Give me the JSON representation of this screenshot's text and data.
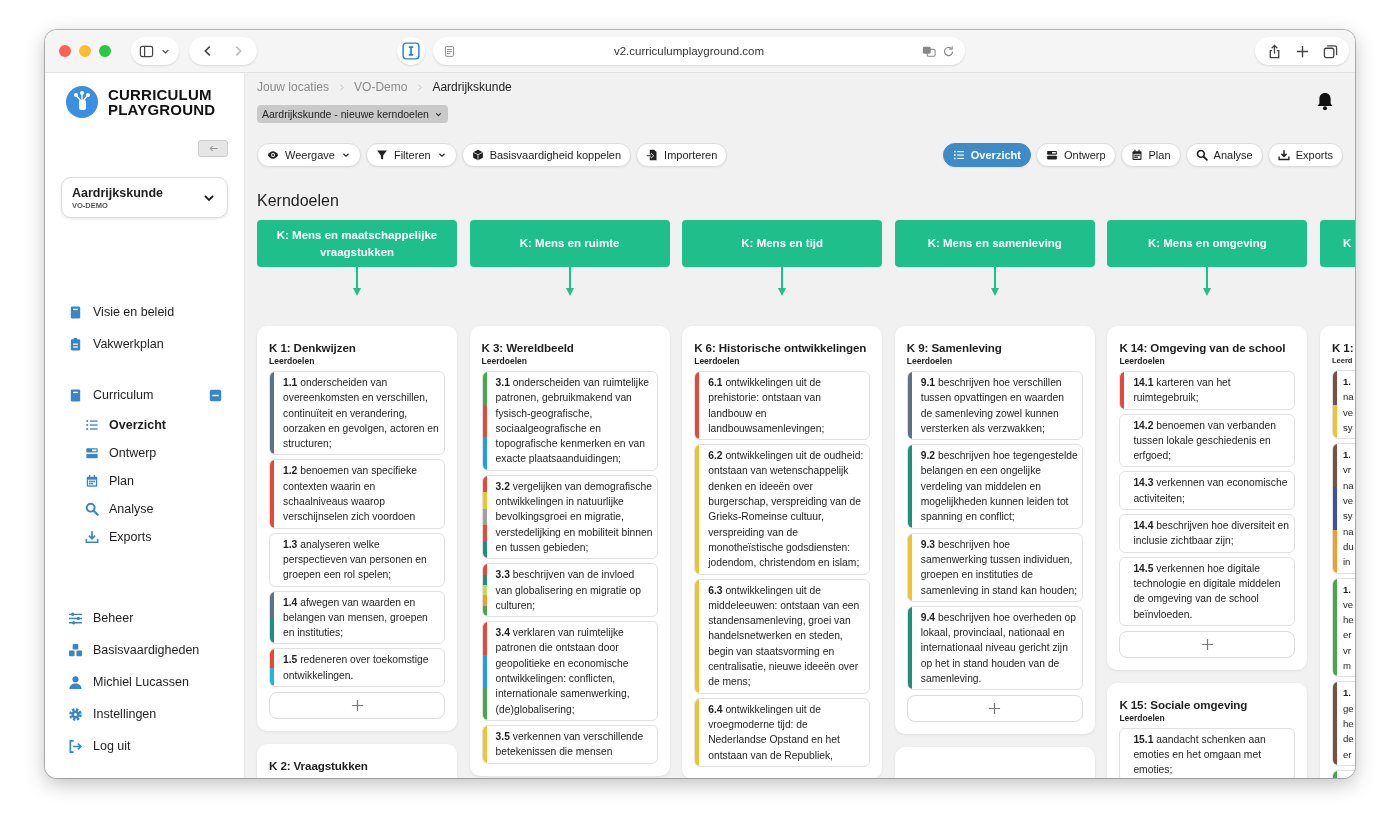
{
  "browser": {
    "url": "v2.curriculumplayground.com"
  },
  "sidebar": {
    "logo_lines": [
      "CURRICULUM",
      "PLAYGROUND"
    ],
    "subject": {
      "name": "Aardrijkskunde",
      "school": "VO-DEMO"
    },
    "nav": [
      {
        "label": "Visie en beleid",
        "selected": false
      },
      {
        "label": "Vakwerkplan",
        "selected": false
      },
      {
        "label": "Curriculum",
        "selected": false,
        "expanded": true,
        "children": [
          {
            "label": "Overzicht",
            "selected": true
          },
          {
            "label": "Ontwerp",
            "selected": false
          },
          {
            "label": "Plan",
            "selected": false
          },
          {
            "label": "Analyse",
            "selected": false
          },
          {
            "label": "Exports",
            "selected": false
          }
        ]
      }
    ],
    "footer_nav": [
      {
        "label": "Beheer",
        "selected": false
      },
      {
        "label": "Basisvaardigheden",
        "selected": false
      },
      {
        "label": "Michiel Lucassen",
        "selected": false
      },
      {
        "label": "Instellingen",
        "selected": false
      },
      {
        "label": "Log uit",
        "selected": false
      }
    ]
  },
  "breadcrumb": [
    "Jouw locaties",
    "VO-Demo",
    "Aardrijkskunde"
  ],
  "version_select": "Aardrijkskunde - nieuwe kerndoelen",
  "tools": [
    {
      "label": "Weergave",
      "dropdown": true
    },
    {
      "label": "Filteren",
      "dropdown": true
    },
    {
      "label": "Basisvaardigheid koppelen",
      "dropdown": false
    },
    {
      "label": "Importeren",
      "dropdown": false
    }
  ],
  "views": [
    {
      "label": "Overzicht",
      "selected": true
    },
    {
      "label": "Ontwerp",
      "selected": false
    },
    {
      "label": "Plan",
      "selected": false
    },
    {
      "label": "Analyse",
      "selected": false
    },
    {
      "label": "Exports",
      "selected": false
    }
  ],
  "section_title": "Kerndoelen",
  "columns": [
    {
      "kind": "full",
      "header": "K: Mens en maatschappelijke vraagstukken",
      "cards": [
        {
          "kind": "addable",
          "title": "K 1: Denkwijzen",
          "label": "Leerdoelen",
          "items": [
            {
              "text": "**1.1** onderscheiden van overeenkomsten en verschillen, continuïteit en verandering, oorzaken en gevolgen, actoren en structuren;",
              "stripes": [
                {
                  "color": "#5d7282"
                }
              ]
            },
            {
              "text": "**1.2** benoemen van specifieke contexten waarin en schaalniveaus waarop verschijnselen zich voordoen",
              "stripes": [
                {
                  "color": "#e5493a"
                }
              ]
            },
            {
              "text": "**1.3** analyseren welke perspectieven van personen en groepen een rol spelen;"
            },
            {
              "text": "**1.4** afwegen van waarden en belangen van mensen, groepen en instituties;",
              "stripes": [
                {
                  "color": "#5d7282"
                },
                {
                  "color": "#1f8f7e"
                }
              ]
            },
            {
              "text": "**1.5** redeneren over toekomstige ontwikkelingen.",
              "stripes": [
                {
                  "color": "#e5493a"
                },
                {
                  "color": "#22b5d6"
                }
              ]
            }
          ]
        },
        {
          "kind": "plain",
          "title": "K 2: Vraagstukken"
        }
      ]
    },
    {
      "kind": "full",
      "header": "K: Mens en ruimte",
      "cards": [
        {
          "kind": "plain",
          "title": "K 3: Wereldbeeld",
          "label": "Leerdoelen",
          "items": [
            {
              "text": "**3.1** onderscheiden van ruimtelijke patronen, gebruikmakend van fysisch-geografische, sociaalgeografische en topografische kenmerken en van exacte plaatsaanduidingen;",
              "stripes": [
                {
                  "color": "#46a84a"
                },
                {
                  "color": "#e5493a"
                },
                {
                  "color": "#1fa0e0"
                }
              ]
            },
            {
              "text": "**3.2** vergelijken van demografische ontwikkelingen in natuurlijke bevolkingsgroei en migratie, verstedelijking en mobiliteit binnen en tussen gebieden;",
              "stripes": [
                {
                  "color": "#e5493a"
                },
                {
                  "color": "#f2c230"
                },
                {
                  "color": "#a0a0a0"
                },
                {
                  "color": "#e5493a"
                },
                {
                  "color": "#1f8f7e"
                }
              ]
            },
            {
              "text": "**3.3** beschrijven van de invloed van globalisering en migratie op culturen;",
              "stripes": [
                {
                  "color": "#e5493a"
                },
                {
                  "color": "#1f8f7e"
                },
                {
                  "color": "#c6dc4c"
                },
                {
                  "color": "#f0a02a"
                },
                {
                  "color": "#46a84a"
                }
              ]
            },
            {
              "text": "**3.4** verklaren van ruimtelijke patronen die ontstaan door geopolitieke en economische ontwikkelingen: conflicten, internationale samenwerking, (de)globalisering;",
              "stripes": [
                {
                  "color": "#e5493a"
                },
                {
                  "color": "#1fa0e0"
                },
                {
                  "color": "#46a84a"
                }
              ]
            },
            {
              "text": "**3.5** verkennen van verschillende betekenissen die mensen",
              "stripes": [
                {
                  "color": "#f2c230"
                }
              ]
            }
          ]
        }
      ]
    },
    {
      "kind": "full",
      "header": "K: Mens en tijd",
      "cards": [
        {
          "kind": "plain",
          "title": "K 6: Historische ontwikkelingen",
          "label": "Leerdoelen",
          "items": [
            {
              "text": "**6.1** ontwikkelingen uit de prehistorie: ontstaan van landbouw en landbouwsamenlevingen;",
              "stripes": [
                {
                  "color": "#e5493a"
                }
              ]
            },
            {
              "text": "**6.2** ontwikkelingen uit de oudheid: ontstaan van wetenschappelijk denken en ideeën over burgerschap, verspreiding van de Grieks-Romeinse cultuur, verspreiding van de monotheïstische godsdiensten: jodendom, christendom en islam;",
              "stripes": [
                {
                  "color": "#f2c230"
                }
              ]
            },
            {
              "text": "**6.3** ontwikkelingen uit de middeleeuwen: ontstaan van een standensamenleving, groei van handelsnetwerken en steden, begin van staatsvorming en centralisatie, nieuwe ideeën over de mens;",
              "stripes": [
                {
                  "color": "#f2c230"
                }
              ]
            },
            {
              "text": "**6.4** ontwikkelingen uit de vroegmoderne tijd: de Nederlandse Opstand en het ontstaan van de Republiek,",
              "stripes": [
                {
                  "color": "#f2c230"
                }
              ]
            }
          ]
        }
      ]
    },
    {
      "kind": "full",
      "header": "K: Mens en samenleving",
      "cards": [
        {
          "kind": "addable",
          "title": "K 9: Samenleving",
          "label": "Leerdoelen",
          "items": [
            {
              "text": "**9.1** beschrijven hoe verschillen tussen opvattingen en waarden de samenleving zowel kunnen versterken als verzwakken;",
              "stripes": [
                {
                  "color": "#5d7282"
                }
              ]
            },
            {
              "text": "**9.2** beschrijven hoe tegengestelde belangen en een ongelijke verdeling van middelen en mogelijkheden kunnen leiden tot spanning en conflict;",
              "stripes": [
                {
                  "color": "#1f8f7e"
                }
              ]
            },
            {
              "text": "**9.3** beschrijven hoe samenwerking tussen individuen, groepen en instituties de samenleving in stand kan houden;",
              "stripes": [
                {
                  "color": "#f2c230"
                }
              ]
            },
            {
              "text": "**9.4** beschrijven hoe overheden op lokaal, provinciaal, nationaal en internationaal niveau gericht zijn op het in stand houden van de samenleving.",
              "stripes": [
                {
                  "color": "#1f8f7e"
                }
              ]
            }
          ]
        },
        {
          "kind": "plain"
        }
      ]
    },
    {
      "kind": "full",
      "header": "K: Mens en omgeving",
      "cards": [
        {
          "kind": "addable",
          "title": "K 14: Omgeving van de school",
          "label": "Leerdoelen",
          "items": [
            {
              "text": "**14.1** karteren van het ruimtegebruik;",
              "stripes": [
                {
                  "color": "#e5493a"
                }
              ]
            },
            {
              "text": "**14.2** benoemen van verbanden tussen lokale geschiedenis en erfgoed;"
            },
            {
              "text": "**14.3** verkennen van economische activiteiten;"
            },
            {
              "text": "**14.4** beschrijven hoe diversiteit en inclusie zichtbaar zijn;"
            },
            {
              "text": "**14.5** verkennen hoe digitale technologie en digitale middelen de omgeving van de school beïnvloeden."
            }
          ]
        },
        {
          "kind": "plain",
          "title": "K 15: Sociale omgeving",
          "label": "Leerdoelen",
          "items": [
            {
              "text": "**15.1** aandacht schenken aan emoties en het omgaan met emoties;"
            }
          ]
        }
      ]
    },
    {
      "kind": "edge",
      "header": "K",
      "cards": [
        {
          "kind": "plain",
          "title": "K 1:",
          "label": "Leerd",
          "items": [
            {
              "text": "**1.**\nna\nve\nsy",
              "stripes": [
                {
                  "color": "#7a5040"
                },
                {
                  "color": "#f2c230"
                }
              ]
            },
            {
              "text": "**1.**\nvr\nna\nve\nsy\nna\ndu\nin",
              "stripes": [
                {
                  "color": "#7a5040"
                },
                {
                  "color": "#3a50b0"
                },
                {
                  "color": "#f0a02a"
                }
              ]
            },
            {
              "text": "**1.**\nve\nhe\ner\nvr\nm",
              "stripes": [
                {
                  "color": "#46a84a"
                }
              ]
            },
            {
              "text": "**1.**\nge\nhe\nde\ner",
              "stripes": [
                {
                  "color": "#7a5040"
                }
              ]
            },
            {
              "stripes": [
                {
                  "color": "#46a84a"
                }
              ]
            }
          ]
        }
      ]
    }
  ]
}
